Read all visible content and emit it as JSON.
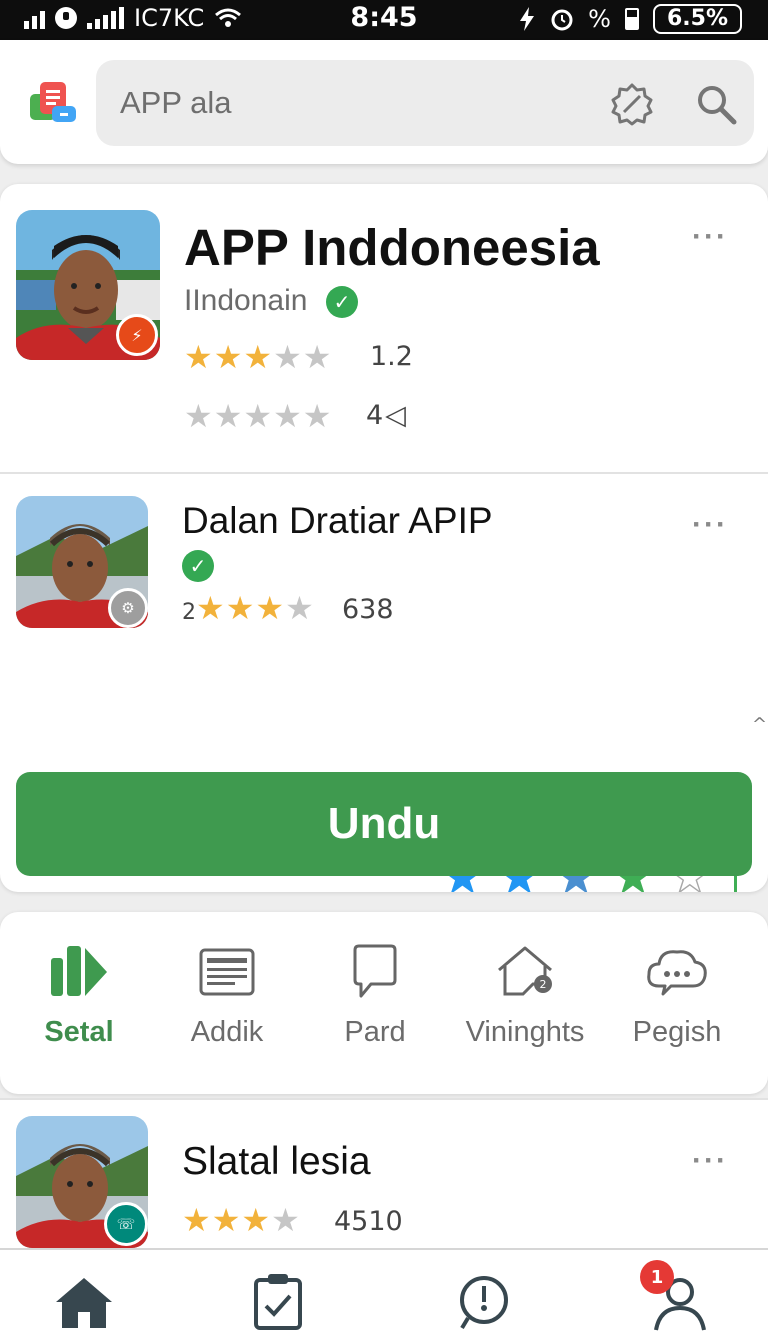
{
  "status_bar": {
    "carrier": "IC7KC",
    "time": "8:45",
    "percent_label": "%",
    "battery": "6.5%"
  },
  "search": {
    "placeholder": "APP ala"
  },
  "apps": [
    {
      "title": "APP Inddoneesia",
      "developer": "IIndonain",
      "rating_stars": 3.5,
      "rating_count": "1.2",
      "secondary_stars": 0,
      "secondary_count": "4"
    },
    {
      "title": "Dalan Dratiar APIP",
      "rating_prefix": "2",
      "rating_stars": 3.5,
      "rating_count": "638",
      "colored_stars_count": 4
    }
  ],
  "install_button": {
    "label": "Undu"
  },
  "categories": [
    {
      "label": "Setal",
      "icon": "apps-grid-icon",
      "active": true
    },
    {
      "label": "Addik",
      "icon": "newspaper-icon",
      "active": false
    },
    {
      "label": "Pard",
      "icon": "chat-bubble-icon",
      "active": false
    },
    {
      "label": "Vininghts",
      "icon": "home-badge-icon",
      "active": false
    },
    {
      "label": "Pegish",
      "icon": "speech-cloud-icon",
      "active": false
    }
  ],
  "list_item": {
    "title": "Slatal lesia",
    "rating_stars": 3.5,
    "rating_count": "4510"
  },
  "bottom_nav": {
    "items": [
      "home-icon",
      "checklist-icon",
      "clock-search-icon",
      "profile-icon"
    ],
    "notification_count": "1"
  },
  "colors": {
    "accent_green": "#3f9a4f",
    "star_gold": "#f2b23b",
    "star_blue": "#2196f3",
    "verified_green": "#34a853",
    "badge_red": "#e53935"
  }
}
